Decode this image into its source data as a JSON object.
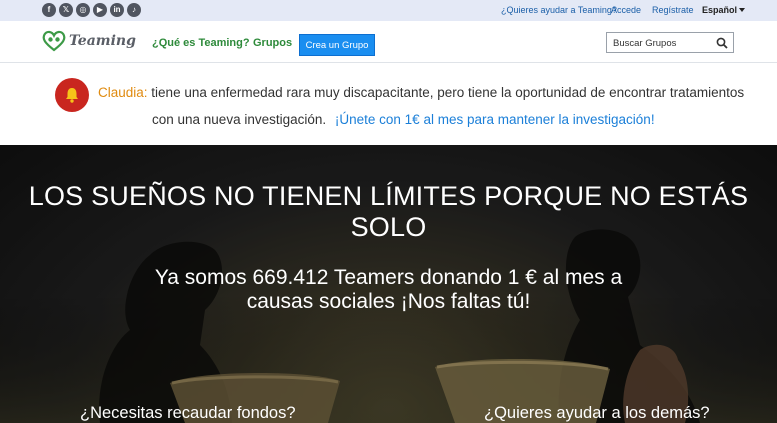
{
  "social": {
    "icons": [
      "facebook-icon",
      "x-icon",
      "instagram-icon",
      "youtube-icon",
      "linkedin-icon",
      "tiktok-icon"
    ],
    "glyphs": [
      "f",
      "𝕏",
      "◎",
      "▶",
      "in",
      "♪"
    ]
  },
  "topbar": {
    "help_link": "¿Quieres ayudar a Teaming?",
    "login_link": "Accede",
    "register_link": "Regístrate",
    "language": "Español"
  },
  "nav": {
    "logo_text": "Teaming",
    "what_is": "¿Qué es Teaming?",
    "groups": "Grupos",
    "create_group": "Crea un Grupo",
    "search_placeholder": "Buscar Grupos"
  },
  "announcement": {
    "name": "Claudia:",
    "text_line1": "tiene una enfermedad rara muy discapacitante, pero tiene la oportunidad de encontrar tratamientos",
    "text_line2": "con una nueva investigación.",
    "join_link": "¡Únete con 1€ al mes para mantener la investigación!"
  },
  "hero": {
    "title_line1": "LOS SUEÑOS NO TIENEN LÍMITES PORQUE NO ESTÁS",
    "title_line2": "SOLO",
    "subtitle_line1": "Ya somos 669.412 Teamers donando 1 € al mes a",
    "subtitle_line2": "causas sociales ¡Nos faltas tú!",
    "cta_left": "¿Necesitas recaudar fondos?",
    "cta_right": "¿Quieres ayudar a los demás?"
  },
  "colors": {
    "accent_green": "#2d8a3a",
    "link_blue": "#1b5fa8",
    "button_blue": "#1a8ef0",
    "alert_red": "#c9261f",
    "name_orange": "#e08b10"
  }
}
